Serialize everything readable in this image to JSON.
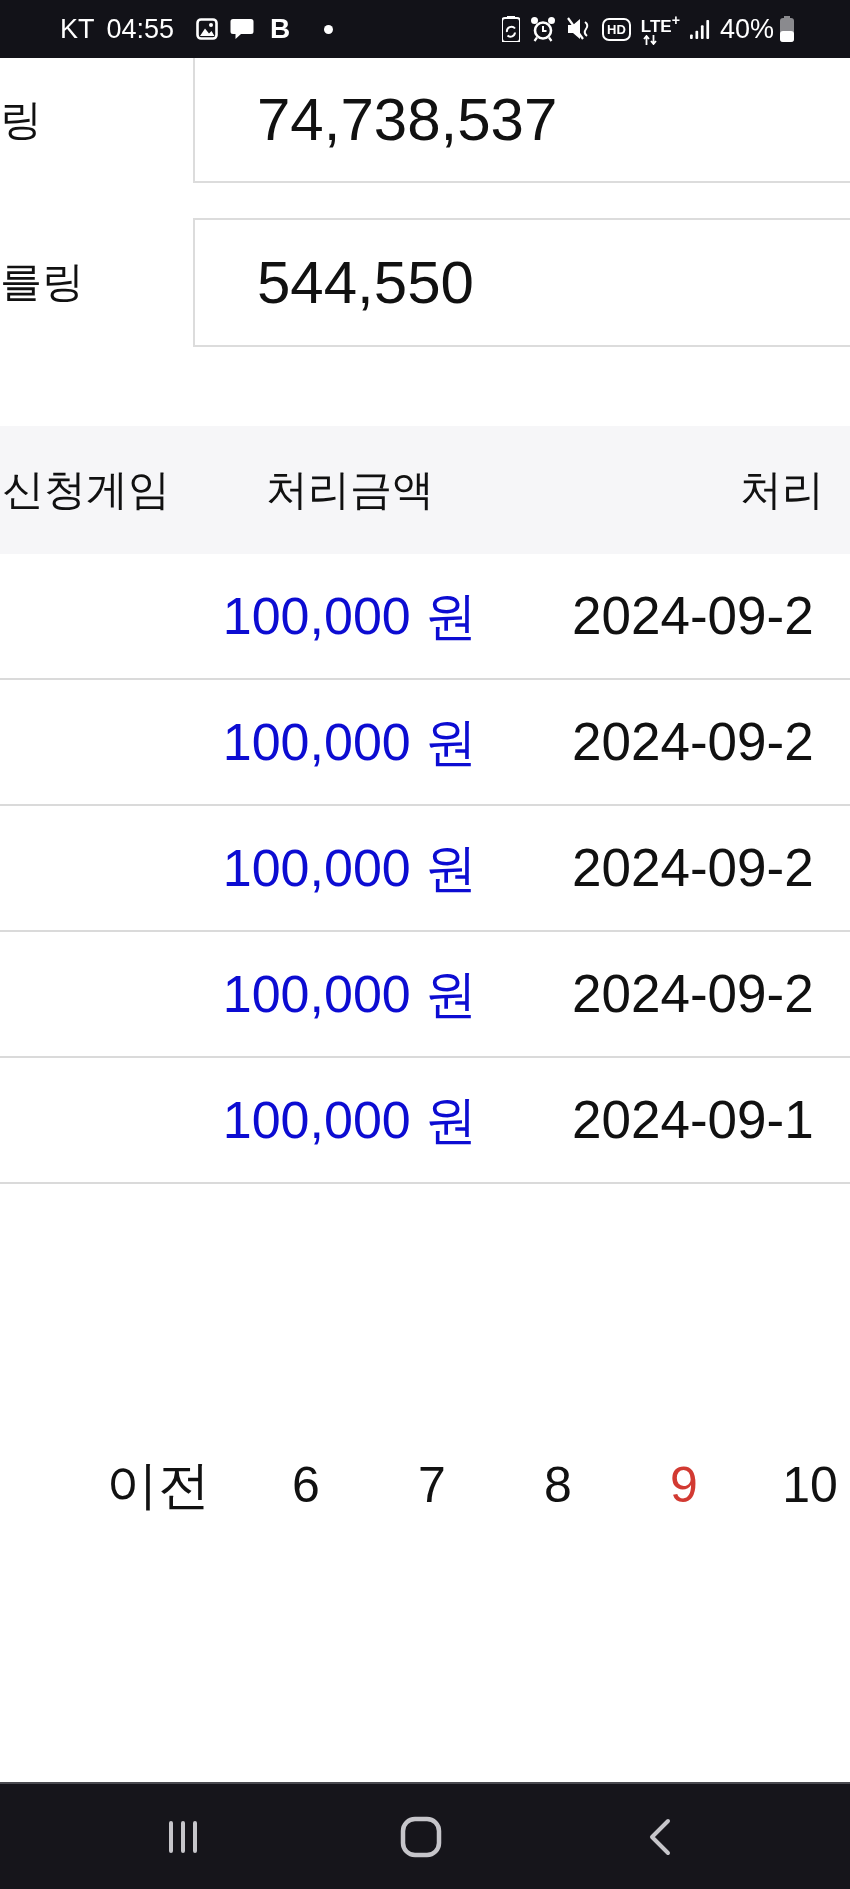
{
  "status_bar": {
    "carrier": "KT",
    "time": "04:55",
    "notification_letter": "B",
    "hd_label": "HD",
    "network": "LTE$^{+}$",
    "battery": "40%"
  },
  "summary": [
    {
      "label": "링",
      "value": "74,738,537"
    },
    {
      "label": "를링",
      "value": "544,550"
    }
  ],
  "table": {
    "columns": [
      "신청게임",
      "처리금액",
      "처리"
    ],
    "rows": [
      {
        "amount": "100,000 원",
        "date": "2024-09-2"
      },
      {
        "amount": "100,000 원",
        "date": "2024-09-2"
      },
      {
        "amount": "100,000 원",
        "date": "2024-09-2"
      },
      {
        "amount": "100,000 원",
        "date": "2024-09-2"
      },
      {
        "amount": "100,000 원",
        "date": "2024-09-1"
      }
    ]
  },
  "pagination": {
    "previous": "이전",
    "pages": [
      {
        "label": "6",
        "selected": false
      },
      {
        "label": "7",
        "selected": false
      },
      {
        "label": "8",
        "selected": false
      },
      {
        "label": "9",
        "selected": true
      },
      {
        "label": "10",
        "selected": false
      }
    ]
  }
}
